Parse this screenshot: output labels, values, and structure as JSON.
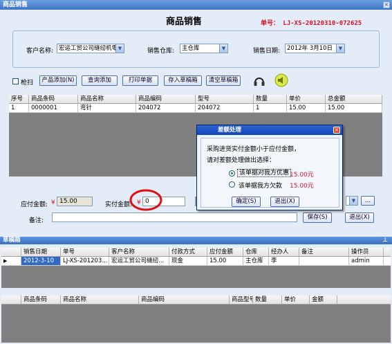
{
  "window": {
    "title": "商品销售",
    "close": "×"
  },
  "header": {
    "title": "商品销售",
    "doc_no": "单号： LJ-XS-20120310-072625"
  },
  "form": {
    "customer_label": "客户名称:",
    "customer_value": "宏运工贸公司缝纫机零",
    "warehouse_label": "销售仓库:",
    "warehouse_value": "主仓库",
    "date_label": "销售日期:",
    "date_value": "2012年 3月10日"
  },
  "toolbar": {
    "scan_label": "枪扫",
    "add_product": "产品添加(N)",
    "query_add": "查询添加",
    "print_doc": "打印单据",
    "save_draft": "存入草稿箱",
    "clear_draft": "清空草稿箱"
  },
  "items_table": {
    "headers": [
      "序号",
      "商品条码",
      "商品名称",
      "商品编码",
      "型号",
      "数量",
      "单价",
      "总金额"
    ],
    "rows": [
      [
        "1",
        "0000001",
        "弯针",
        "204072",
        "204072",
        "1",
        "15.00",
        "15.00"
      ]
    ]
  },
  "totals": {
    "payable_label": "应付金额:",
    "payable_value": "15.00",
    "actual_label": "实付金额:",
    "actual_value": "0",
    "currency": "¥",
    "remark_label": "备注:",
    "save_btn": "保存(S)",
    "exit_btn": "退出(X)",
    "more_btn": "..."
  },
  "dialog": {
    "title": "差额处理",
    "msg1": "采购进货实付金额小于应付金额，",
    "msg2": "请对差额处理做出选择：",
    "opt1": "该单据对我方优惠",
    "opt1_amount": "15.00元",
    "opt2": "该单据我方欠款",
    "opt2_amount": "15.00元",
    "ok": "确定(S)",
    "cancel": "退出(X)"
  },
  "drafts": {
    "title": "草稿箱",
    "pin": "⊥",
    "headers": [
      "销售日期",
      "单号",
      "客户名称",
      "付款方式",
      "应付金额",
      "仓库",
      "经办人",
      "备注",
      "操作员"
    ],
    "rows": [
      [
        "2012-3-10",
        "LJ-XS-201203...",
        "宏运工贸公司缝纫...",
        "现金",
        "15.00",
        "主仓库",
        "李",
        "",
        "admin"
      ]
    ]
  },
  "detail_table": {
    "headers": [
      "商品条码",
      "商品名称",
      "商品编码",
      "商品型号",
      "数量",
      "单价",
      "金额"
    ]
  },
  "colors": {
    "accent": "#3f74c6",
    "doc_no": "#d8102a",
    "highlight": "#e01010"
  }
}
